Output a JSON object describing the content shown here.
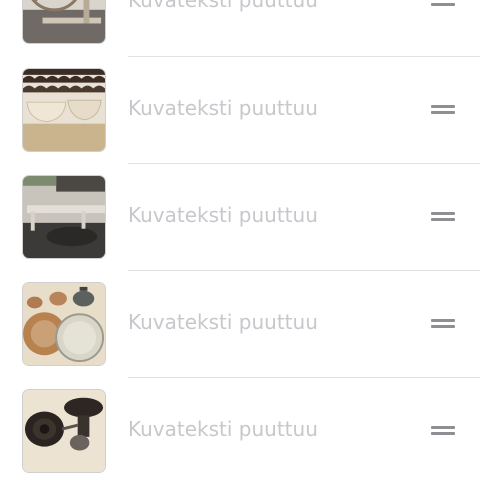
{
  "list": {
    "items": [
      {
        "caption": "Kuvateksti puuttuu",
        "image": "spinning-wheel-photo",
        "handle_icon": "reorder-handle-icon"
      },
      {
        "caption": "Kuvateksti puuttuu",
        "image": "ceramic-bowls-photo",
        "handle_icon": "reorder-handle-icon"
      },
      {
        "caption": "Kuvateksti puuttuu",
        "image": "wooden-bench-photo",
        "handle_icon": "reorder-handle-icon"
      },
      {
        "caption": "Kuvateksti puuttuu",
        "image": "teapots-and-plates-photo",
        "handle_icon": "reorder-handle-icon"
      },
      {
        "caption": "Kuvateksti puuttuu",
        "image": "dark-wheels-photo",
        "handle_icon": "reorder-handle-icon"
      }
    ]
  },
  "colors": {
    "caption_placeholder": "#c7c7cc",
    "handle": "#8e8e93",
    "divider": "#e2e2e2"
  }
}
